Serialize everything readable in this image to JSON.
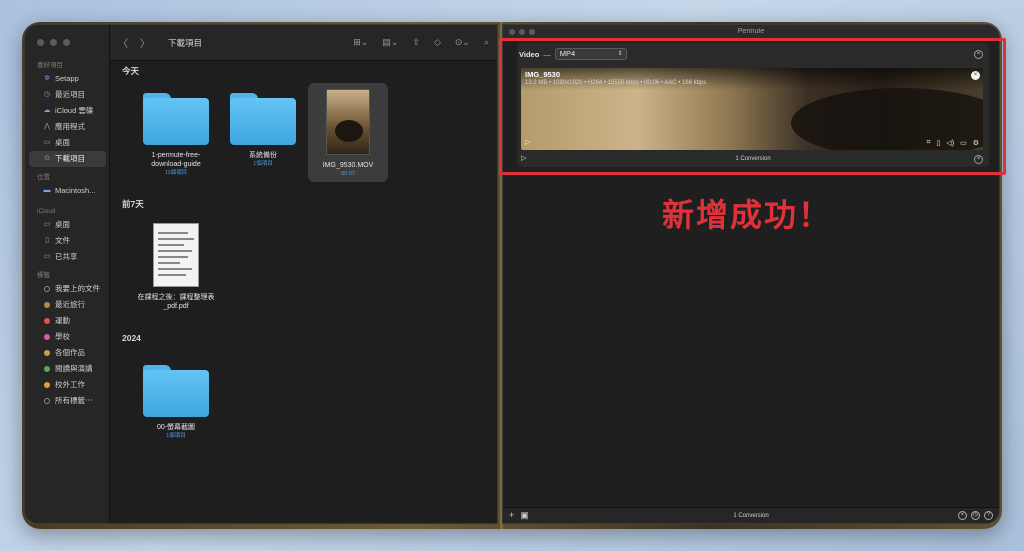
{
  "finder": {
    "window_title": "下載項目",
    "sidebar": {
      "favorites_head": "喜好項目",
      "favorites": [
        {
          "label": "Setapp",
          "icon": "setapp-icon"
        },
        {
          "label": "最近項目",
          "icon": "clock-icon"
        },
        {
          "label": "iCloud 雲碟",
          "icon": "cloud-icon"
        },
        {
          "label": "應用程式",
          "icon": "apps-icon"
        },
        {
          "label": "桌面",
          "icon": "desktop-icon"
        },
        {
          "label": "下載項目",
          "icon": "download-icon",
          "active": true
        }
      ],
      "locations_head": "位置",
      "locations": [
        {
          "label": "Macintosh...",
          "icon": "disk-icon"
        }
      ],
      "icloud_head": "iCloud",
      "icloud": [
        {
          "label": "桌面",
          "icon": "desktop-icon"
        },
        {
          "label": "文件",
          "icon": "document-icon"
        },
        {
          "label": "已共享",
          "icon": "shared-folder-icon"
        }
      ],
      "tags_head": "標籤",
      "tags": [
        {
          "label": "我要上的文件",
          "color": "#8a8a8a"
        },
        {
          "label": "最近旅行",
          "color": "#b8864a"
        },
        {
          "label": "運動",
          "color": "#e0534a"
        },
        {
          "label": "學校",
          "color": "#d95d96"
        },
        {
          "label": "各個作品",
          "color": "#c9a04a"
        },
        {
          "label": "閱讀與演講",
          "color": "#5aa75a"
        },
        {
          "label": "校外工作",
          "color": "#d9a13a"
        },
        {
          "label": "所有標籤⋯",
          "color": "#8a8a8a"
        }
      ]
    },
    "groups": [
      {
        "head": "今天"
      },
      {
        "head": "前7天"
      },
      {
        "head": "2024"
      }
    ],
    "files": {
      "f1": {
        "name": "1-permute-free-download-guide",
        "sub": "11個項目"
      },
      "f2": {
        "name": "系統備份",
        "sub": "1個項目"
      },
      "f3": {
        "name": "IMG_9530.MOV",
        "sub": "00:07"
      },
      "f4": {
        "name": "在課程之後：課程整理表_pdf.pdf",
        "sub": ""
      },
      "f5": {
        "name": "00-螢幕截圖",
        "sub": "1個項目"
      }
    }
  },
  "permute": {
    "title": "Permute",
    "type_label": "Video",
    "dash": "—",
    "format": "MP4",
    "video_name": "IMG_9530",
    "video_meta": "13.2 MB • 1080x1920 • H264 • 15550 kbps • 00:06 • AAC • 166 kbps",
    "card_conversion": "1 Conversion",
    "bottom_conversion": "1 Conversion"
  },
  "callout": "新增成功！",
  "colors": {
    "accent_red": "#e0313b",
    "folder_blue": "#4fb4ec",
    "link_blue": "#4f9be8"
  }
}
